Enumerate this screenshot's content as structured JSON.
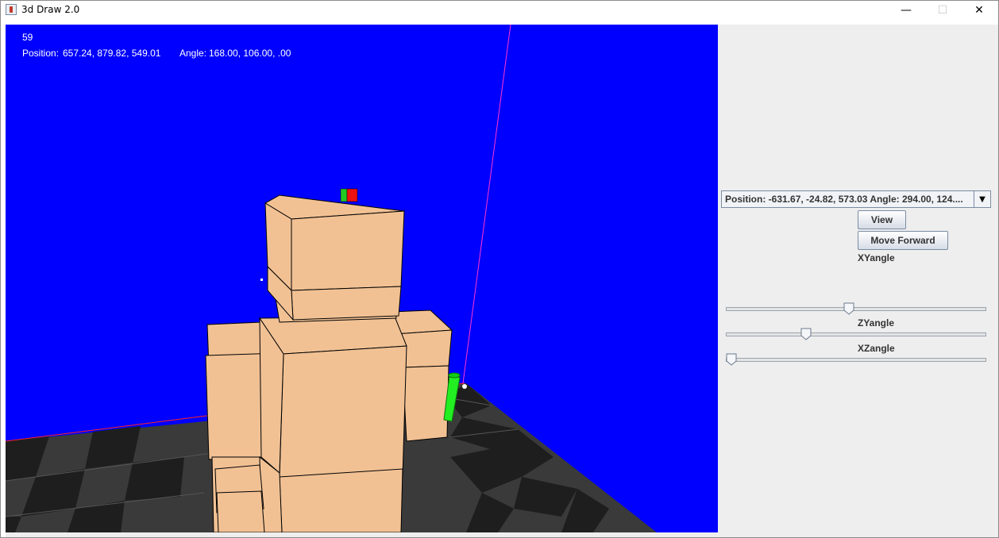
{
  "window": {
    "title": "3d Draw 2.0",
    "minimize_glyph": "—",
    "maximize_glyph": "☐",
    "close_glyph": "✕"
  },
  "viewport": {
    "fps": "59",
    "position_label": "Position:",
    "position": "657.24, 879.82, 549.01",
    "angle_label": "Angle:",
    "angle": "168.00, 106.00, .00"
  },
  "side": {
    "camera_select": {
      "selected": "Position: -631.67, -24.82, 573.03      Angle: 294.00, 124....",
      "arrow_icon": "triangle-down"
    },
    "view_button": "View",
    "forward_button": "Move Forward",
    "sliders": [
      {
        "label": "XYangle",
        "value": 0.47
      },
      {
        "label": "ZYangle",
        "value": 0.3
      },
      {
        "label": "XZangle",
        "value": 0.0
      }
    ]
  }
}
